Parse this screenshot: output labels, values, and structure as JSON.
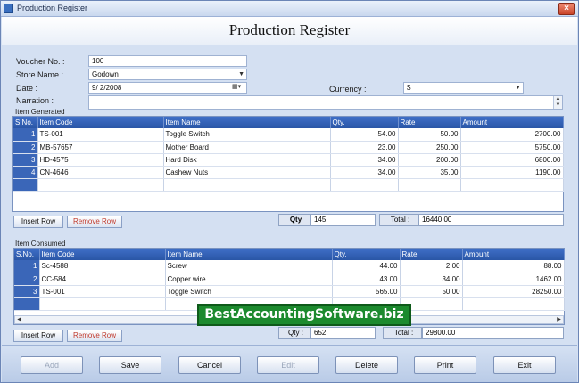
{
  "window": {
    "title": "Production Register",
    "close_label": "×"
  },
  "header": {
    "title": "Production Register"
  },
  "form": {
    "voucher_label": "Voucher No. :",
    "voucher_value": "100",
    "store_label": "Store Name :",
    "store_value": "Godown",
    "date_label": "Date :",
    "date_value": "9/ 2/2008",
    "currency_label": "Currency :",
    "currency_value": "$",
    "narration_label": "Narration :",
    "narration_value": ""
  },
  "generated": {
    "section_label": "Item Generated",
    "columns": [
      "S.No.",
      "Item Code",
      "Item Name",
      "Qty.",
      "Rate",
      "Amount"
    ],
    "rows": [
      {
        "sno": "1",
        "code": "TS-001",
        "name": "Toggle Switch",
        "qty": "54.00",
        "rate": "50.00",
        "amount": "2700.00"
      },
      {
        "sno": "2",
        "code": "MB-57657",
        "name": "Mother Board",
        "qty": "23.00",
        "rate": "250.00",
        "amount": "5750.00"
      },
      {
        "sno": "3",
        "code": "HD-4575",
        "name": "Hard Disk",
        "qty": "34.00",
        "rate": "200.00",
        "amount": "6800.00"
      },
      {
        "sno": "4",
        "code": "CN-4646",
        "name": "Cashew Nuts",
        "qty": "34.00",
        "rate": "35.00",
        "amount": "1190.00"
      }
    ],
    "insert_label": "Insert Row",
    "remove_label": "Remove Row",
    "qty_label": "Qty",
    "qty_value": "145",
    "total_label": "Total :",
    "total_value": "16440.00"
  },
  "consumed": {
    "section_label": "Item Consumed",
    "columns": [
      "S.No.",
      "Item Code",
      "Item Name",
      "Qty.",
      "Rate",
      "Amount"
    ],
    "rows": [
      {
        "sno": "1",
        "code": "Sc-4588",
        "name": "Screw",
        "qty": "44.00",
        "rate": "2.00",
        "amount": "88.00"
      },
      {
        "sno": "2",
        "code": "CC-584",
        "name": "Copper wire",
        "qty": "43.00",
        "rate": "34.00",
        "amount": "1462.00"
      },
      {
        "sno": "3",
        "code": "TS-001",
        "name": "Toggle Switch",
        "qty": "565.00",
        "rate": "50.00",
        "amount": "28250.00"
      }
    ],
    "insert_label": "Insert Row",
    "remove_label": "Remove Row",
    "qty_label": "Qty :",
    "qty_value": "652",
    "total_label": "Total :",
    "total_value": "29800.00"
  },
  "buttons": {
    "add": "Add",
    "save": "Save",
    "cancel": "Cancel",
    "edit": "Edit",
    "delete": "Delete",
    "print": "Print",
    "exit": "Exit"
  },
  "watermark": "BestAccountingSoftware.biz"
}
